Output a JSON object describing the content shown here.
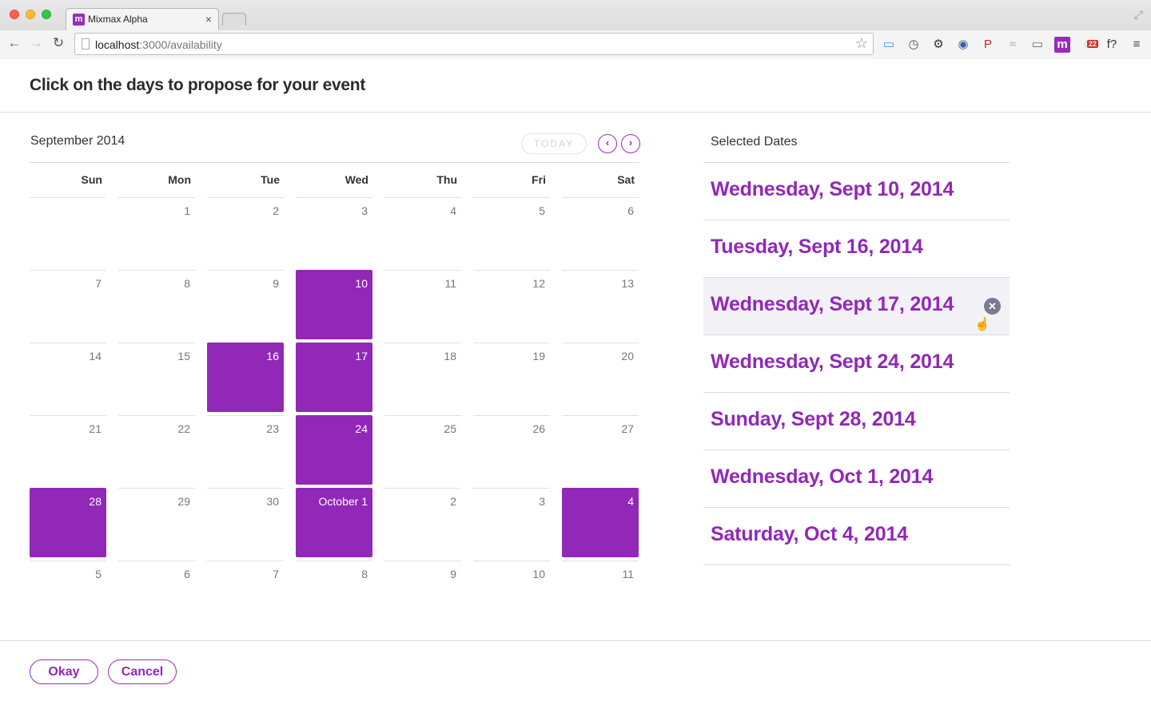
{
  "browser": {
    "tab_title": "Mixmax Alpha",
    "tab_favicon": "m",
    "tab_close": "×",
    "url_host": "localhost",
    "url_rest": ":3000/availability",
    "back_icon": "←",
    "forward_icon": "→",
    "reload_icon": "↻",
    "star_icon": "☆",
    "fullscreen_icon": "⤢",
    "extensions": [
      {
        "name": "window-icon",
        "glyph": "▭",
        "color": "#4a90d9"
      },
      {
        "name": "clock-icon",
        "glyph": "◷",
        "color": "#555555"
      },
      {
        "name": "gear-icon",
        "glyph": "⚙",
        "color": "#333333"
      },
      {
        "name": "camera-icon",
        "glyph": "◉",
        "color": "#3a5ea8"
      },
      {
        "name": "pinterest-icon",
        "glyph": "P",
        "color": "#cb2027"
      },
      {
        "name": "wave-icon",
        "glyph": "≈",
        "color": "#aaaaaa"
      },
      {
        "name": "cast-icon",
        "glyph": "▭",
        "color": "#666666"
      },
      {
        "name": "mixmax-icon",
        "glyph": "m",
        "color": "#9a2ac1"
      },
      {
        "name": "notification-icon",
        "glyph": "◌",
        "color": "#f0862a",
        "badge": "22"
      },
      {
        "name": "font-icon",
        "glyph": "f?",
        "color": "#333333"
      },
      {
        "name": "menu-icon",
        "glyph": "≡",
        "color": "#444444"
      }
    ]
  },
  "header": {
    "title": "Click on the days to propose for your event"
  },
  "calendar": {
    "month_title": "September 2014",
    "today_label": "TODAY",
    "prev_icon": "‹",
    "next_icon": "›",
    "weekdays": [
      "Sun",
      "Mon",
      "Tue",
      "Wed",
      "Thu",
      "Fri",
      "Sat"
    ],
    "weeks": [
      [
        {
          "label": "",
          "selected": false
        },
        {
          "label": "1",
          "selected": false
        },
        {
          "label": "2",
          "selected": false
        },
        {
          "label": "3",
          "selected": false
        },
        {
          "label": "4",
          "selected": false
        },
        {
          "label": "5",
          "selected": false
        },
        {
          "label": "6",
          "selected": false
        }
      ],
      [
        {
          "label": "7",
          "selected": false
        },
        {
          "label": "8",
          "selected": false
        },
        {
          "label": "9",
          "selected": false
        },
        {
          "label": "10",
          "selected": true
        },
        {
          "label": "11",
          "selected": false
        },
        {
          "label": "12",
          "selected": false
        },
        {
          "label": "13",
          "selected": false
        }
      ],
      [
        {
          "label": "14",
          "selected": false
        },
        {
          "label": "15",
          "selected": false
        },
        {
          "label": "16",
          "selected": true
        },
        {
          "label": "17",
          "selected": true
        },
        {
          "label": "18",
          "selected": false
        },
        {
          "label": "19",
          "selected": false
        },
        {
          "label": "20",
          "selected": false
        }
      ],
      [
        {
          "label": "21",
          "selected": false
        },
        {
          "label": "22",
          "selected": false
        },
        {
          "label": "23",
          "selected": false
        },
        {
          "label": "24",
          "selected": true
        },
        {
          "label": "25",
          "selected": false
        },
        {
          "label": "26",
          "selected": false
        },
        {
          "label": "27",
          "selected": false
        }
      ],
      [
        {
          "label": "28",
          "selected": true
        },
        {
          "label": "29",
          "selected": false
        },
        {
          "label": "30",
          "selected": false
        },
        {
          "label": "October 1",
          "selected": true
        },
        {
          "label": "2",
          "selected": false
        },
        {
          "label": "3",
          "selected": false
        },
        {
          "label": "4",
          "selected": true
        }
      ],
      [
        {
          "label": "5",
          "selected": false
        },
        {
          "label": "6",
          "selected": false
        },
        {
          "label": "7",
          "selected": false
        },
        {
          "label": "8",
          "selected": false
        },
        {
          "label": "9",
          "selected": false
        },
        {
          "label": "10",
          "selected": false
        },
        {
          "label": "11",
          "selected": false
        }
      ]
    ]
  },
  "selected_panel": {
    "title": "Selected Dates",
    "remove_icon": "✕",
    "cursor_icon": "☝",
    "hovered_index": 2,
    "dates": [
      "Wednesday, Sept 10, 2014",
      "Tuesday, Sept 16, 2014",
      "Wednesday, Sept 17, 2014",
      "Wednesday, Sept 24, 2014",
      "Sunday, Sept 28, 2014",
      "Wednesday, Oct 1, 2014",
      "Saturday, Oct 4, 2014"
    ]
  },
  "footer": {
    "okay_label": "Okay",
    "cancel_label": "Cancel"
  },
  "colors": {
    "accent": "#9128b8",
    "border": "#dcdae0",
    "hover_bg": "#f2f1f6"
  }
}
